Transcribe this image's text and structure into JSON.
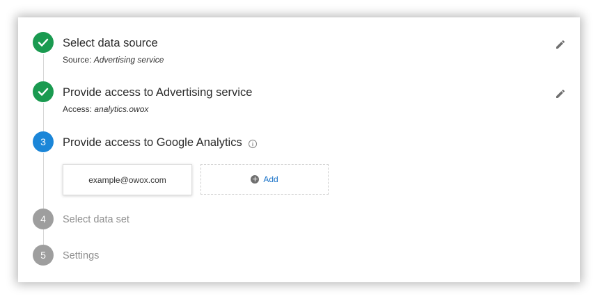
{
  "colors": {
    "done": "#1a9a50",
    "active": "#1b86d8",
    "pending": "#9e9e9e",
    "link": "#1a73c8"
  },
  "steps": [
    {
      "status": "done",
      "title": "Select data source",
      "sub_label": "Source:",
      "sub_value": "Advertising service",
      "icon": "check-icon"
    },
    {
      "status": "done",
      "title": "Provide access to Advertising service",
      "sub_label": "Access:",
      "sub_value": "analytics.owox",
      "icon": "check-icon"
    },
    {
      "status": "active",
      "number": "3",
      "title": "Provide access to Google Analytics",
      "info_icon": "info-icon"
    },
    {
      "status": "pending",
      "number": "4",
      "title": "Select data set"
    },
    {
      "status": "pending",
      "number": "5",
      "title": "Settings"
    }
  ],
  "accounts": {
    "selected": "example@owox.com",
    "add_label": "Add"
  }
}
